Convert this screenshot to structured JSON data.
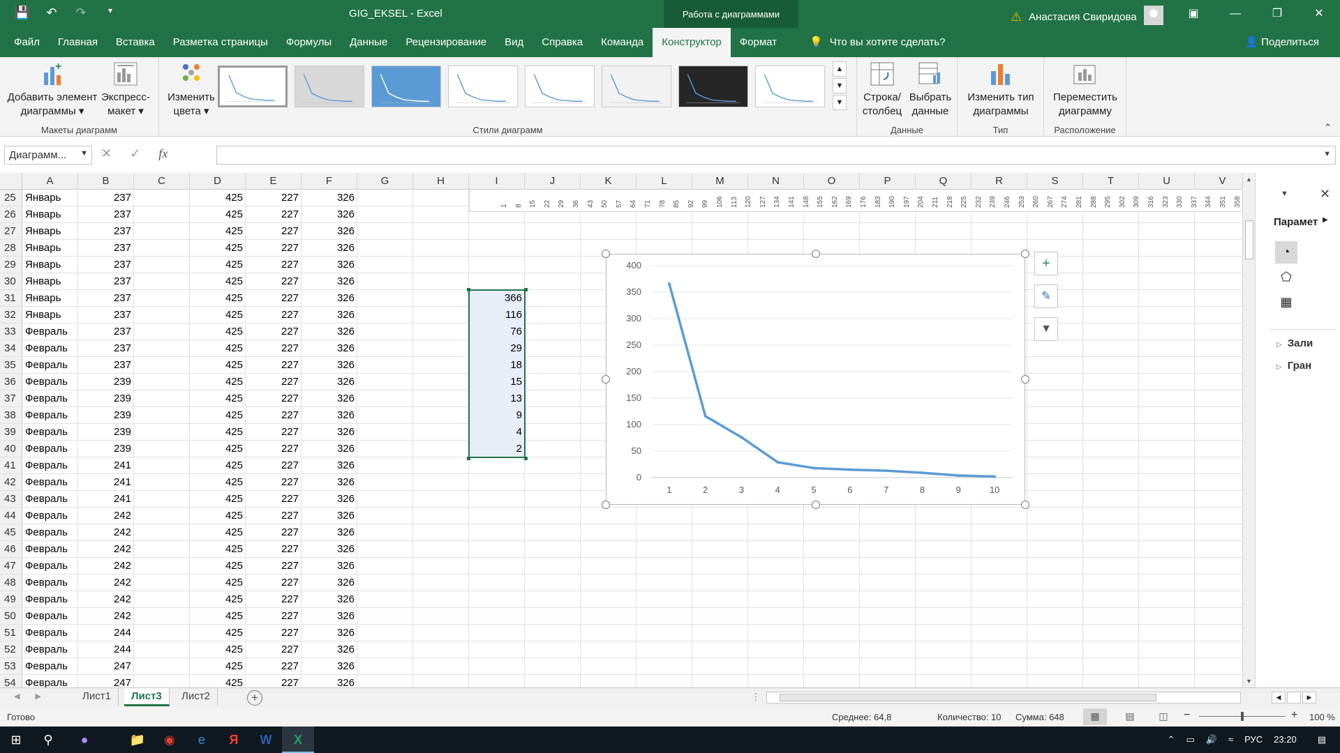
{
  "title_bar": {
    "doc_title": "GIG_EKSEL  -  Excel",
    "context_group": "Работа с диаграммами",
    "user_name": "Анастасия Свиридова"
  },
  "tabs": [
    "Файл",
    "Главная",
    "Вставка",
    "Разметка страницы",
    "Формулы",
    "Данные",
    "Рецензирование",
    "Вид",
    "Справка",
    "Команда",
    "Конструктор",
    "Формат"
  ],
  "active_tab": "Конструктор",
  "tell_me": "Что вы хотите сделать?",
  "share": "Поделиться",
  "ribbon": {
    "add_element_1": "Добавить элемент",
    "add_element_2": "диаграммы ▾",
    "express_1": "Экспресс-",
    "express_2": "макет ▾",
    "layouts_group": "Макеты диаграмм",
    "colors_1": "Изменить",
    "colors_2": "цвета ▾",
    "styles_group": "Стили диаграмм",
    "rowcol_1": "Строка/",
    "rowcol_2": "столбец",
    "select_data_1": "Выбрать",
    "select_data_2": "данные",
    "data_group": "Данные",
    "change_type_1": "Изменить тип",
    "change_type_2": "диаграммы",
    "type_group": "Тип",
    "move_1": "Переместить",
    "move_2": "диаграмму",
    "location_group": "Расположение"
  },
  "name_box": "Диаграмм...",
  "fx_label": "fx",
  "columns": [
    "A",
    "B",
    "C",
    "D",
    "E",
    "F",
    "G",
    "H",
    "I",
    "J",
    "K",
    "L",
    "M",
    "N",
    "O",
    "P",
    "Q",
    "R",
    "S",
    "T",
    "U",
    "V"
  ],
  "rows": [
    {
      "n": "25",
      "a": "Январь",
      "b": "237",
      "d": "425",
      "e": "227",
      "f": "326"
    },
    {
      "n": "26",
      "a": "Январь",
      "b": "237",
      "d": "425",
      "e": "227",
      "f": "326"
    },
    {
      "n": "27",
      "a": "Январь",
      "b": "237",
      "d": "425",
      "e": "227",
      "f": "326"
    },
    {
      "n": "28",
      "a": "Январь",
      "b": "237",
      "d": "425",
      "e": "227",
      "f": "326"
    },
    {
      "n": "29",
      "a": "Январь",
      "b": "237",
      "d": "425",
      "e": "227",
      "f": "326"
    },
    {
      "n": "30",
      "a": "Январь",
      "b": "237",
      "d": "425",
      "e": "227",
      "f": "326"
    },
    {
      "n": "31",
      "a": "Январь",
      "b": "237",
      "d": "425",
      "e": "227",
      "f": "326",
      "i": "366"
    },
    {
      "n": "32",
      "a": "Январь",
      "b": "237",
      "d": "425",
      "e": "227",
      "f": "326",
      "i": "116"
    },
    {
      "n": "33",
      "a": "Февраль",
      "b": "237",
      "d": "425",
      "e": "227",
      "f": "326",
      "i": "76"
    },
    {
      "n": "34",
      "a": "Февраль",
      "b": "237",
      "d": "425",
      "e": "227",
      "f": "326",
      "i": "29"
    },
    {
      "n": "35",
      "a": "Февраль",
      "b": "237",
      "d": "425",
      "e": "227",
      "f": "326",
      "i": "18"
    },
    {
      "n": "36",
      "a": "Февраль",
      "b": "239",
      "d": "425",
      "e": "227",
      "f": "326",
      "i": "15"
    },
    {
      "n": "37",
      "a": "Февраль",
      "b": "239",
      "d": "425",
      "e": "227",
      "f": "326",
      "i": "13"
    },
    {
      "n": "38",
      "a": "Февраль",
      "b": "239",
      "d": "425",
      "e": "227",
      "f": "326",
      "i": "9"
    },
    {
      "n": "39",
      "a": "Февраль",
      "b": "239",
      "d": "425",
      "e": "227",
      "f": "326",
      "i": "4"
    },
    {
      "n": "40",
      "a": "Февраль",
      "b": "239",
      "d": "425",
      "e": "227",
      "f": "326",
      "i": "2"
    },
    {
      "n": "41",
      "a": "Февраль",
      "b": "241",
      "d": "425",
      "e": "227",
      "f": "326"
    },
    {
      "n": "42",
      "a": "Февраль",
      "b": "241",
      "d": "425",
      "e": "227",
      "f": "326"
    },
    {
      "n": "43",
      "a": "Февраль",
      "b": "241",
      "d": "425",
      "e": "227",
      "f": "326"
    },
    {
      "n": "44",
      "a": "Февраль",
      "b": "242",
      "d": "425",
      "e": "227",
      "f": "326"
    },
    {
      "n": "45",
      "a": "Февраль",
      "b": "242",
      "d": "425",
      "e": "227",
      "f": "326"
    },
    {
      "n": "46",
      "a": "Февраль",
      "b": "242",
      "d": "425",
      "e": "227",
      "f": "326"
    },
    {
      "n": "47",
      "a": "Февраль",
      "b": "242",
      "d": "425",
      "e": "227",
      "f": "326"
    },
    {
      "n": "48",
      "a": "Февраль",
      "b": "242",
      "d": "425",
      "e": "227",
      "f": "326"
    },
    {
      "n": "49",
      "a": "Февраль",
      "b": "242",
      "d": "425",
      "e": "227",
      "f": "326"
    },
    {
      "n": "50",
      "a": "Февраль",
      "b": "242",
      "d": "425",
      "e": "227",
      "f": "326"
    },
    {
      "n": "51",
      "a": "Февраль",
      "b": "244",
      "d": "425",
      "e": "227",
      "f": "326"
    },
    {
      "n": "52",
      "a": "Февраль",
      "b": "244",
      "d": "425",
      "e": "227",
      "f": "326"
    },
    {
      "n": "53",
      "a": "Февраль",
      "b": "247",
      "d": "425",
      "e": "227",
      "f": "326"
    },
    {
      "n": "54",
      "a": "Февраль",
      "b": "247",
      "d": "425",
      "e": "227",
      "f": "326"
    }
  ],
  "top_strip_labels": [
    "1",
    "8",
    "15",
    "22",
    "29",
    "36",
    "43",
    "50",
    "57",
    "64",
    "71",
    "78",
    "85",
    "92",
    "99",
    "106",
    "113",
    "120",
    "127",
    "134",
    "141",
    "148",
    "155",
    "162",
    "169",
    "176",
    "183",
    "190",
    "197",
    "204",
    "211",
    "218",
    "225",
    "232",
    "239",
    "246",
    "253",
    "260",
    "267",
    "274",
    "281",
    "288",
    "295",
    "302",
    "309",
    "316",
    "323",
    "330",
    "337",
    "344",
    "351",
    "358"
  ],
  "chart_data": {
    "type": "line",
    "x": [
      1,
      2,
      3,
      4,
      5,
      6,
      7,
      8,
      9,
      10
    ],
    "values": [
      366,
      116,
      76,
      29,
      18,
      15,
      13,
      9,
      4,
      2
    ],
    "ylim": [
      0,
      400
    ],
    "yticks": [
      0,
      50,
      100,
      150,
      200,
      250,
      300,
      350,
      400
    ],
    "xticks": [
      "1",
      "2",
      "3",
      "4",
      "5",
      "6",
      "7",
      "8",
      "9",
      "10"
    ],
    "grid": true,
    "line_color": "#5b9bd5"
  },
  "side_pane": {
    "title": "Парамет",
    "item1": "Зали",
    "item2": "Гран"
  },
  "sheets": [
    "Лист1",
    "Лист3",
    "Лист2"
  ],
  "active_sheet": "Лист3",
  "status": {
    "ready": "Готово",
    "average": "Среднее: 64,8",
    "count": "Количество: 10",
    "sum": "Сумма: 648",
    "zoom": "100 %"
  },
  "taskbar": {
    "lang": "РУС",
    "time": "23:20"
  },
  "colors": {
    "excel_green": "#217346",
    "accent_dark": "#185c37",
    "selection": "#e8eef8"
  }
}
